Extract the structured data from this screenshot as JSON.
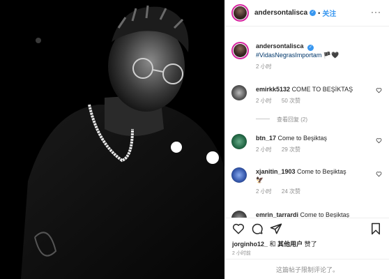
{
  "post": {
    "username": "andersontalisca",
    "verified_mark": "✓",
    "separator": "•",
    "follow_label": "关注",
    "more_label": "···"
  },
  "caption": {
    "username": "andersontalisca",
    "hashtag": "#VidasNegrasImportam",
    "emoji": "🏴🖤",
    "time": "2 小时"
  },
  "comments": [
    {
      "username": "emirkk5132",
      "text": "COME TO BEŞİKTAŞ",
      "time": "2 小时",
      "likes": "50 次赞",
      "replies": "查看回复 (2)"
    },
    {
      "username": "btn_17",
      "text": "Come to Beşiktaş",
      "time": "2 小时",
      "likes": "29 次赞"
    },
    {
      "username": "xjanitin_1903",
      "text": "Come to Beşiktaş",
      "emoji": "🦅",
      "time": "2 小时",
      "likes": "24 次赞"
    },
    {
      "username": "emrin_tarrardi",
      "text": "Come to Beşiktaş"
    }
  ],
  "actions": {
    "liked_by_user": "jorginho12_",
    "liked_middle": "和",
    "liked_others": "其他用户",
    "liked_suffix": "赞了",
    "time": "2 小时前",
    "comments_limited": "这篇帖子限制评论了。"
  },
  "icons": [
    "heart-icon",
    "comment-icon",
    "share-icon",
    "bookmark-icon",
    "more-options-icon"
  ],
  "colors": {
    "link_blue": "#3897f0",
    "hashtag": "#00376b",
    "muted": "#8e8e8e",
    "text": "#262626"
  }
}
